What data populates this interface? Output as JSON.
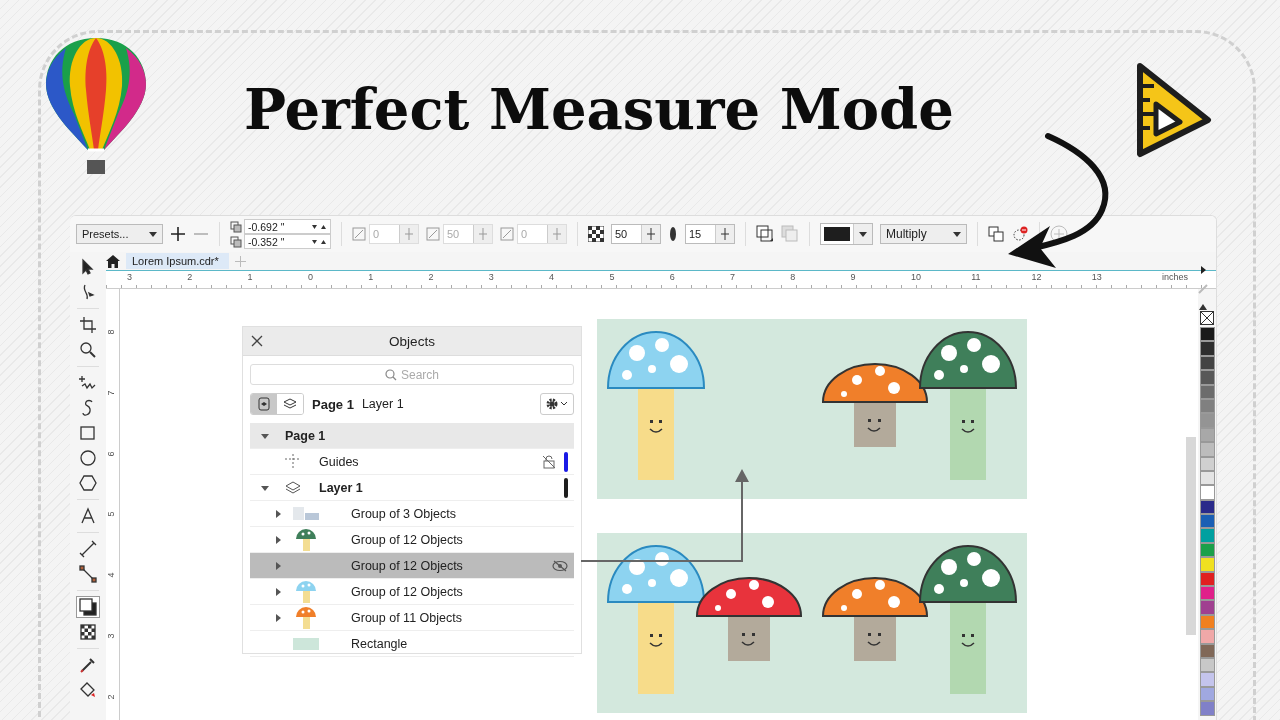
{
  "title": "Perfect Measure Mode",
  "toolbar": {
    "preset": "Presets...",
    "offset_x": "-0.692 \"",
    "offset_y": "-0.352 \"",
    "shadow_fields": [
      {
        "value": "0",
        "disabled": true
      },
      {
        "value": "50",
        "disabled": true
      },
      {
        "value": "0",
        "disabled": true
      }
    ],
    "transparency": "50",
    "feather": "15",
    "shadow_swatch": {
      "color": "#1e1e1e"
    },
    "blend_mode": "Multiply"
  },
  "document_tab": {
    "label": "Lorem Ipsum.cdr*",
    "selected": true
  },
  "ruler": {
    "top_labels": [
      "3",
      "2",
      "1",
      "0",
      "1",
      "2",
      "3",
      "4",
      "5",
      "6",
      "7",
      "8",
      "9",
      "10",
      "11",
      "12",
      "13"
    ],
    "unit": "inches",
    "side_labels": [
      "8",
      "7",
      "6",
      "5",
      "4",
      "3",
      "2"
    ]
  },
  "tools": [
    {
      "kind": "pick",
      "selected": false
    },
    {
      "kind": "shape",
      "selected": false
    },
    {
      "kind": "crop",
      "selected": false
    },
    {
      "kind": "zoom",
      "selected": false
    },
    {
      "kind": "freehand",
      "selected": false
    },
    {
      "kind": "curve",
      "selected": false
    },
    {
      "kind": "rectangle",
      "selected": false
    },
    {
      "kind": "ellipse",
      "selected": false
    },
    {
      "kind": "polygon",
      "selected": false
    },
    {
      "kind": "text",
      "selected": false
    },
    {
      "kind": "dimension",
      "selected": false
    },
    {
      "kind": "connector",
      "selected": false
    },
    {
      "kind": "shadow",
      "selected": true
    },
    {
      "kind": "transparency",
      "selected": false
    },
    {
      "kind": "eyedropper",
      "selected": false
    },
    {
      "kind": "fill",
      "selected": false
    }
  ],
  "objects_panel": {
    "title": "Objects",
    "search": {
      "placeholder": "Search"
    },
    "page_label": "Page 1",
    "layer_label": "Layer 1",
    "tree": [
      {
        "label": "Page 1",
        "kind": "page",
        "expanded": true,
        "selected": false,
        "children": [
          {
            "label": "Guides",
            "kind": "guides",
            "color": "#1a1ae6",
            "selected": false
          },
          {
            "label": "Layer 1",
            "kind": "layer",
            "color": "#1e1e1e",
            "expanded": true,
            "selected": false,
            "children": [
              {
                "label": "Group of 3 Objects",
                "kind": "image",
                "expanded": false,
                "selected": false,
                "hidden": false
              },
              {
                "label": "Group of 12 Objects",
                "kind": "mushroom",
                "color": "#3f7f5a",
                "expanded": false,
                "selected": false,
                "hidden": false
              },
              {
                "label": "Group of 12 Objects",
                "kind": "group",
                "expanded": false,
                "selected": true,
                "hidden": true
              },
              {
                "label": "Group of 12 Objects",
                "kind": "mushroom",
                "color": "#8dd3f0",
                "expanded": false,
                "selected": false,
                "hidden": false
              },
              {
                "label": "Group of 11 Objects",
                "kind": "mushroom",
                "color": "#f07f2a",
                "expanded": false,
                "selected": false,
                "hidden": false
              },
              {
                "label": "Rectangle",
                "kind": "rectangle",
                "color": "#cde6da",
                "selected": false,
                "hidden": false
              }
            ]
          }
        ]
      }
    ]
  },
  "canvas": {
    "panels": [
      {
        "mushrooms": [
          {
            "kind": "tall",
            "cap": {
              "color": "#8dd3f0"
            },
            "stem": {
              "color": "#f7dc8a"
            }
          },
          {
            "kind": "short",
            "cap": {
              "color": "#f07f2a"
            },
            "stem": {
              "color": "#b3aa9b"
            }
          },
          {
            "kind": "tall",
            "cap": {
              "color": "#3f7f5a"
            },
            "stem": {
              "color": "#b2d8b0"
            }
          }
        ]
      },
      {
        "mushrooms": [
          {
            "kind": "tall",
            "cap": {
              "color": "#8dd3f0"
            },
            "stem": {
              "color": "#f7dc8a"
            }
          },
          {
            "kind": "short",
            "cap": {
              "color": "#e8333c"
            },
            "stem": {
              "color": "#b3aa9b"
            }
          },
          {
            "kind": "short",
            "cap": {
              "color": "#f07f2a"
            },
            "stem": {
              "color": "#b3aa9b"
            }
          },
          {
            "kind": "tall",
            "cap": {
              "color": "#3f7f5a"
            },
            "stem": {
              "color": "#b2d8b0"
            }
          }
        ]
      }
    ]
  },
  "palette": [
    {
      "color": "#1a1a1a"
    },
    {
      "color": "#2e2e2e"
    },
    {
      "color": "#444444"
    },
    {
      "color": "#585858"
    },
    {
      "color": "#6c6c6c"
    },
    {
      "color": "#808080"
    },
    {
      "color": "#949494"
    },
    {
      "color": "#a8a8a8"
    },
    {
      "color": "#bcbcbc"
    },
    {
      "color": "#d0d0d0"
    },
    {
      "color": "#e4e4e4"
    },
    {
      "color": "#ffffff"
    },
    {
      "color": "#2a2a8a"
    },
    {
      "color": "#1a5fb4"
    },
    {
      "color": "#00a0a0"
    },
    {
      "color": "#1aa04a"
    },
    {
      "color": "#f0e020"
    },
    {
      "color": "#e02020"
    },
    {
      "color": "#e0208a"
    },
    {
      "color": "#a04090"
    },
    {
      "color": "#f08020"
    },
    {
      "color": "#f0a8a8"
    },
    {
      "color": "#806858"
    },
    {
      "color": "#c8c8c8"
    },
    {
      "color": "#c4c4ec"
    },
    {
      "color": "#a0a8e0"
    },
    {
      "color": "#8080c8"
    }
  ]
}
